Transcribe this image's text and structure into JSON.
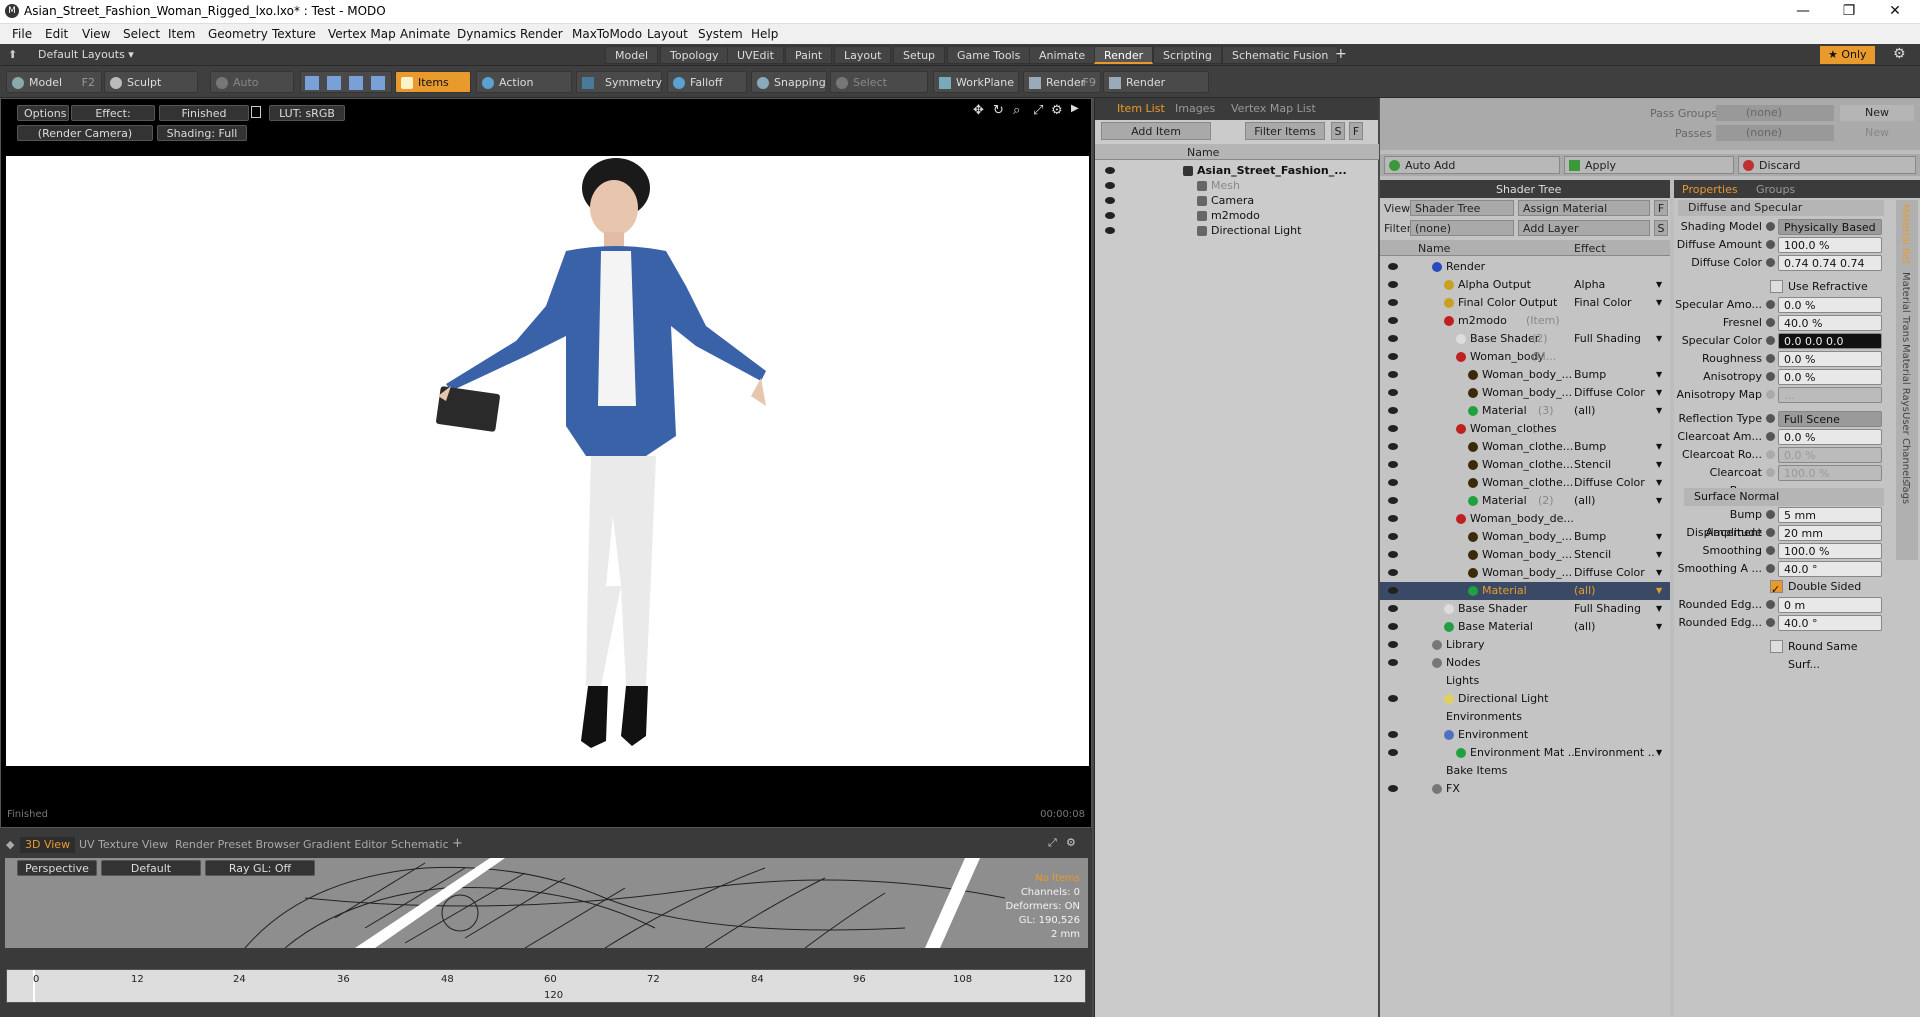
{
  "window": {
    "title": "Asian_Street_Fashion_Woman_Rigged_lxo.lxo* : Test - MODO",
    "app_icon": "modo-logo-icon",
    "min_glyph": "—",
    "max_glyph": "❐",
    "close_glyph": "✕"
  },
  "menu": [
    "File",
    "Edit",
    "View",
    "Select",
    "Item",
    "Geometry",
    "Texture",
    "Vertex Map",
    "Animate",
    "Dynamics",
    "Render",
    "MaxToModo",
    "Layout",
    "System",
    "Help"
  ],
  "layoutbar": {
    "layouts_label": "Default Layouts ▾",
    "tabs": [
      "Model",
      "Topology",
      "UVEdit",
      "Paint",
      "Layout",
      "Setup",
      "Game Tools",
      "Animate",
      "Render",
      "Scripting",
      "Schematic Fusion"
    ],
    "active_tab": "Render",
    "plus": "+",
    "only_label": "★ Only"
  },
  "toolbar": {
    "model": "Model",
    "model_key": "F2",
    "sculpt": "Sculpt",
    "auto_select": "Auto Select",
    "items": "Items",
    "action_center": "Action Center",
    "symmetry": "Symmetry",
    "falloff": "Falloff",
    "snapping": "Snapping",
    "select_through": "Select Through",
    "workplane": "WorkPlane",
    "render": "Render",
    "render_key": "F9",
    "render_window": "Render Window"
  },
  "viewport": {
    "options": "Options",
    "effect": "Effect: (Shadi...",
    "finished": "Finished",
    "lut": "LUT: sRGB",
    "camera": "(Render Camera)",
    "shading": "Shading: Full",
    "status": "Finished",
    "time": "00:00:08"
  },
  "bottom_tabs": [
    "3D View",
    "UV Texture View",
    "Render Preset Browser",
    "Gradient Editor",
    "Schematic"
  ],
  "bottom_view": {
    "perspective": "Perspective",
    "default": "Default",
    "raygl": "Ray GL: Off",
    "info": [
      "No Items",
      "Channels: 0",
      "Deformers: ON",
      "GL: 190,526",
      "2 mm"
    ]
  },
  "timeline": {
    "ticks": [
      "0",
      "12",
      "24",
      "36",
      "48",
      "60",
      "72",
      "84",
      "96",
      "108",
      "120"
    ],
    "ticks2": [
      "120"
    ]
  },
  "item_list": {
    "tabs": [
      "Item List",
      "Images",
      "Vertex Map List"
    ],
    "add_item": "Add Item",
    "filter_items": "Filter Items",
    "S": "S",
    "F": "F",
    "name_col": "Name",
    "rows": [
      {
        "label": "Asian_Street_Fashion_...",
        "depth": 0
      },
      {
        "label": "Mesh",
        "depth": 1
      },
      {
        "label": "Camera",
        "depth": 1
      },
      {
        "label": "m2modo",
        "depth": 1
      },
      {
        "label": "Directional Light",
        "depth": 1
      }
    ]
  },
  "pass": {
    "pass_groups": "Pass Groups",
    "passes": "Passes",
    "none": "(none)",
    "new": "New"
  },
  "actions": {
    "auto_add": "Auto Add",
    "apply": "Apply",
    "discard": "Discard"
  },
  "shader_tree": {
    "title": "Shader Tree",
    "view_label": "View",
    "view_value": "Shader Tree",
    "assign_material": "Assign Material",
    "filter_label": "Filter",
    "filter_value": "(none)",
    "add_layer": "Add Layer",
    "F": "F",
    "S": "S",
    "name_col": "Name",
    "effect_col": "Effect",
    "rows": [
      {
        "label": "Render",
        "effect": "",
        "depth": 0,
        "icon": "#2a4ac0"
      },
      {
        "label": "Alpha Output",
        "effect": "Alpha",
        "depth": 1,
        "icon": "#c9a020"
      },
      {
        "label": "Final Color Output",
        "effect": "Final Color",
        "depth": 1,
        "icon": "#c9a020"
      },
      {
        "label": "m2modo",
        "sub": "(Item)",
        "effect": "",
        "depth": 1,
        "icon": "#c02020"
      },
      {
        "label": "Base Shader",
        "sub": "(2)",
        "effect": "Full Shading",
        "depth": 2,
        "icon": "#dddddd"
      },
      {
        "label": "Woman_body",
        "sub": "(M...",
        "effect": "",
        "depth": 2,
        "icon": "#c02020"
      },
      {
        "label": "Woman_body_...",
        "effect": "Bump",
        "depth": 3,
        "icon": "#3a2a0a"
      },
      {
        "label": "Woman_body_...",
        "effect": "Diffuse Color",
        "depth": 3,
        "icon": "#3a2a0a"
      },
      {
        "label": "Material",
        "sub": "(3)",
        "effect": "(all)",
        "depth": 3,
        "icon": "#20a040"
      },
      {
        "label": "Woman_clothes",
        "sub": "(...",
        "effect": "",
        "depth": 2,
        "icon": "#c02020"
      },
      {
        "label": "Woman_clothe...",
        "effect": "Bump",
        "depth": 3,
        "icon": "#3a2a0a"
      },
      {
        "label": "Woman_clothe...",
        "effect": "Stencil",
        "depth": 3,
        "icon": "#3a2a0a"
      },
      {
        "label": "Woman_clothe...",
        "effect": "Diffuse Color",
        "depth": 3,
        "icon": "#3a2a0a"
      },
      {
        "label": "Material",
        "sub": "(2)",
        "effect": "(all)",
        "depth": 3,
        "icon": "#20a040"
      },
      {
        "label": "Woman_body_de...",
        "effect": "",
        "depth": 2,
        "icon": "#c02020"
      },
      {
        "label": "Woman_body_...",
        "effect": "Bump",
        "depth": 3,
        "icon": "#3a2a0a"
      },
      {
        "label": "Woman_body_...",
        "effect": "Stencil",
        "depth": 3,
        "icon": "#3a2a0a"
      },
      {
        "label": "Woman_body_...",
        "effect": "Diffuse Color",
        "depth": 3,
        "icon": "#3a2a0a"
      },
      {
        "label": "Material",
        "effect": "(all)",
        "depth": 3,
        "icon": "#20a040",
        "selected": true
      },
      {
        "label": "Base Shader",
        "effect": "Full Shading",
        "depth": 1,
        "icon": "#dddddd"
      },
      {
        "label": "Base Material",
        "effect": "(all)",
        "depth": 1,
        "icon": "#20a040"
      },
      {
        "label": "Library",
        "effect": "",
        "depth": 0,
        "icon": "#777777"
      },
      {
        "label": "Nodes",
        "effect": "",
        "depth": 0,
        "icon": "#777777"
      },
      {
        "label": "Lights",
        "effect": "",
        "depth": 0,
        "icon": ""
      },
      {
        "label": "Directional Light",
        "effect": "",
        "depth": 1,
        "icon": "#e0d060"
      },
      {
        "label": "Environments",
        "effect": "",
        "depth": 0,
        "icon": ""
      },
      {
        "label": "Environment",
        "effect": "",
        "depth": 1,
        "icon": "#5070c0"
      },
      {
        "label": "Environment Mat ...",
        "effect": "Environment ...",
        "depth": 2,
        "icon": "#20a040"
      },
      {
        "label": "Bake Items",
        "effect": "",
        "depth": 0,
        "icon": ""
      },
      {
        "label": "FX",
        "effect": "",
        "depth": 0,
        "icon": "#777777"
      }
    ]
  },
  "properties": {
    "tabs": [
      "Properties",
      "Groups"
    ],
    "section": "Diffuse and Specular",
    "side_tabs": [
      "Material Ref",
      "Material Trans",
      "Material Rays",
      "User Channels",
      "Tags"
    ],
    "rows": [
      {
        "label": "Shading Model",
        "value": "Physically Based",
        "type": "dropdown"
      },
      {
        "label": "Diffuse Amount",
        "value": "100.0 %",
        "type": "field"
      },
      {
        "label": "Diffuse Color",
        "value": "0.74   0.74   0.74",
        "type": "color"
      },
      {
        "label": "",
        "value": "Use Refractive In...",
        "type": "check"
      },
      {
        "label": "Specular Amo...",
        "value": "0.0 %",
        "type": "field"
      },
      {
        "label": "Fresnel",
        "value": "40.0 %",
        "type": "field"
      },
      {
        "label": "Specular Color",
        "value": "0.0     0.0     0.0",
        "type": "dark"
      },
      {
        "label": "Roughness",
        "value": "0.0 %",
        "type": "field"
      },
      {
        "label": "Anisotropy",
        "value": "0.0 %",
        "type": "field"
      },
      {
        "label": "Anisotropy Map",
        "value": "...",
        "type": "disabled"
      },
      {
        "label": "Reflection Type",
        "value": "Full Scene",
        "type": "dropdown"
      },
      {
        "label": "Clearcoat Am...",
        "value": "0.0 %",
        "type": "field"
      },
      {
        "label": "Clearcoat Ro...",
        "value": "0.0 %",
        "type": "disabled"
      },
      {
        "label": "Clearcoat Bump",
        "value": "100.0 %",
        "type": "disabled"
      },
      {
        "label": "",
        "value": "Surface Normal",
        "type": "section"
      },
      {
        "label": "Bump Amplitude",
        "value": "5 mm",
        "type": "field"
      },
      {
        "label": "Displacement ...",
        "value": "20 mm",
        "type": "field"
      },
      {
        "label": "Smoothing",
        "value": "100.0 %",
        "type": "field"
      },
      {
        "label": "Smoothing A ...",
        "value": "40.0 °",
        "type": "field"
      },
      {
        "label": "",
        "value": "Double Sided",
        "type": "checked"
      },
      {
        "label": "Rounded Edg...",
        "value": "0 m",
        "type": "field"
      },
      {
        "label": "Rounded Edg...",
        "value": "40.0 °",
        "type": "field"
      },
      {
        "label": "",
        "value": "Round Same Surf...",
        "type": "check"
      }
    ]
  }
}
